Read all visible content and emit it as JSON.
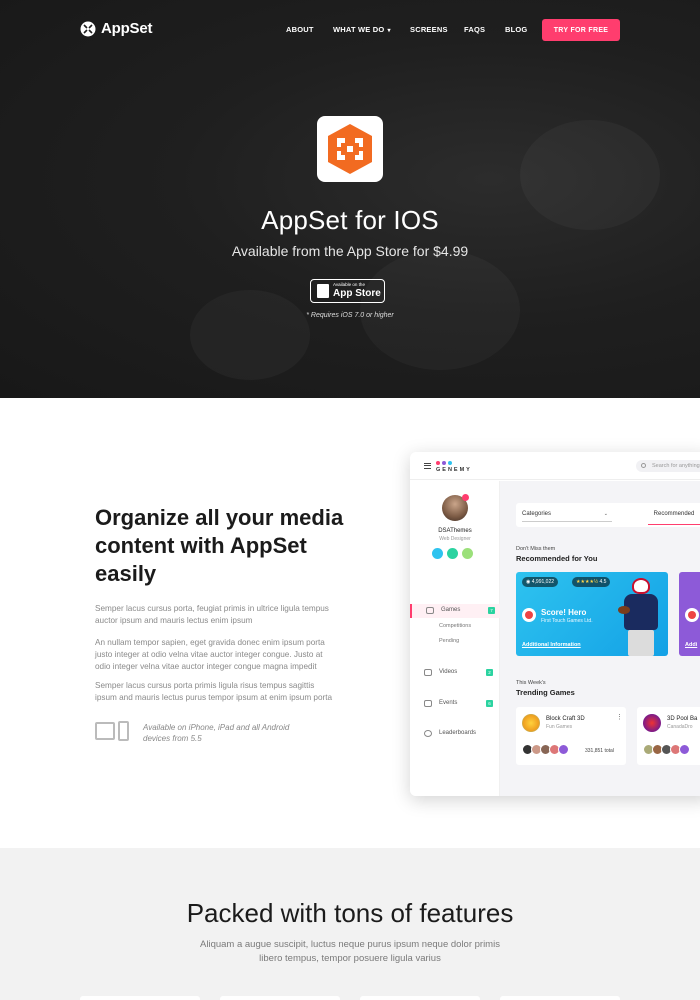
{
  "nav": {
    "logo": "AppSet",
    "items": [
      "ABOUT",
      "WHAT WE DO",
      "SCREENS",
      "FAQS",
      "BLOG"
    ],
    "cta": "TRY FOR FREE"
  },
  "hero": {
    "title": "AppSet for IOS",
    "subtitle": "Available from the App Store for $4.99",
    "store_badge_small": "Available on the",
    "store_badge_big": "App Store",
    "requires": "* Requires iOS 7.0 or higher"
  },
  "organize": {
    "title": "Organize all your media content with AppSet easily",
    "paragraphs": [
      "Semper lacus cursus porta, feugiat primis in ultrice ligula tempus auctor ipsum and mauris lectus enim ipsum",
      "An nullam tempor sapien, eget gravida donec enim ipsum porta justo integer at odio velna vitae auctor integer congue. Justo at odio integer velna vitae auctor integer congue magna impedit",
      "Semper lacus cursus porta primis ligula risus tempus sagittis ipsum and mauris lectus purus tempor ipsum at enim ipsum porta"
    ],
    "devices_note": "Available on iPhone, iPad and all Android devices from 5.5"
  },
  "mockup": {
    "brand": "GENEMY",
    "search_placeholder": "Search for anything",
    "user_name": "DSAThemes",
    "user_role": "Web Designer",
    "menu": [
      {
        "label": "Games",
        "badge": "7"
      },
      {
        "label": "Videos",
        "badge": "2"
      },
      {
        "label": "Events",
        "badge": "6"
      },
      {
        "label": "Leaderboards",
        "badge": ""
      }
    ],
    "submenu": [
      "Competitions",
      "Pending"
    ],
    "categories_label": "Categories",
    "tab_label": "Recommended",
    "section1_small": "Don't Miss them",
    "section1_big": "Recommended for You",
    "featured": {
      "players": "4,991,022",
      "rating": "4.5",
      "title": "Score! Hero",
      "studio": "First Touch Games Ltd.",
      "link": "Additional Information"
    },
    "featured2_link": "Addi",
    "section2_small": "This Week's",
    "section2_big": "Trending Games",
    "games": [
      {
        "title": "Block Craft 3D",
        "studio": "Fun Games",
        "total": "331,851 total"
      },
      {
        "title": "3D Pool Ba",
        "studio": "CanadaDro",
        "total": ""
      }
    ]
  },
  "features": {
    "title": "Packed with tons of features",
    "text": "Aliquam a augue suscipit, luctus neque purus ipsum neque dolor primis libero tempus, tempor posuere ligula varius"
  },
  "colors": {
    "accent": "#ff3d6e",
    "hero_bg": "#1f1f1f",
    "app_icon": "#f26b21",
    "card_blue": "#13a1e6",
    "badge_green": "#2bd3a0"
  }
}
